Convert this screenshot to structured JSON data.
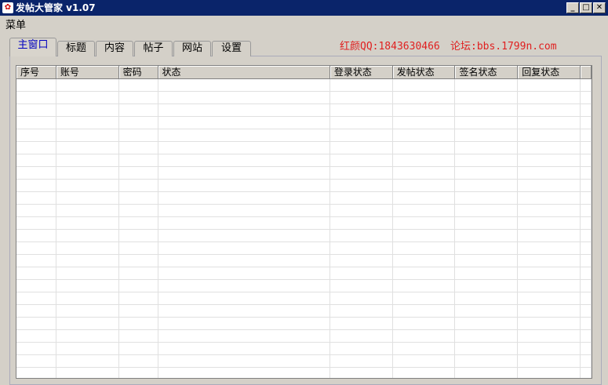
{
  "window": {
    "title": "发帖大管家 v1.07",
    "minimize": "_",
    "maximize": "□",
    "close": "✕"
  },
  "menu": {
    "label": "菜单"
  },
  "tabs": [
    {
      "label": "主窗口",
      "active": true
    },
    {
      "label": "标题"
    },
    {
      "label": "内容"
    },
    {
      "label": "帖子"
    },
    {
      "label": "网站"
    },
    {
      "label": "设置"
    }
  ],
  "info": {
    "qq": "红颜QQ:1843630466",
    "forum": "论坛:bbs.1799n.com"
  },
  "table": {
    "columns": [
      "序号",
      "账号",
      "密码",
      "状态",
      "登录状态",
      "发帖状态",
      "签名状态",
      "回复状态",
      ""
    ],
    "rows": []
  }
}
